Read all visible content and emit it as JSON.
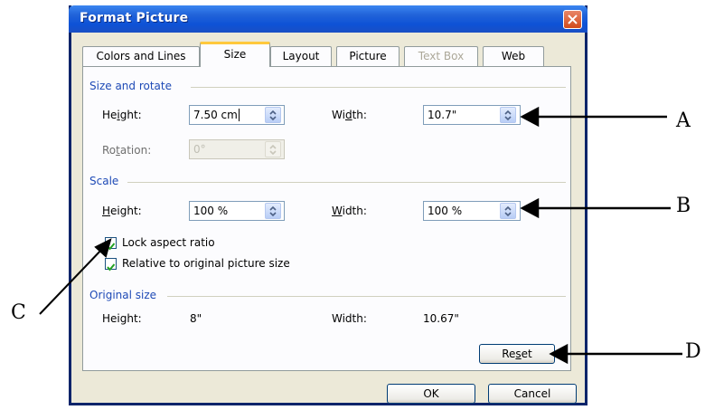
{
  "window": {
    "title": "Format Picture"
  },
  "tabs": [
    {
      "label": "Colors and Lines",
      "state": "normal"
    },
    {
      "label": "Size",
      "state": "active"
    },
    {
      "label": "Layout",
      "state": "normal"
    },
    {
      "label": "Picture",
      "state": "normal"
    },
    {
      "label": "Text Box",
      "state": "disabled"
    },
    {
      "label": "Web",
      "state": "normal"
    }
  ],
  "size_rotate": {
    "title": "Size and rotate",
    "height_label": "Height:",
    "height_value": "7.50 cm",
    "width_label": "Width:",
    "width_value": "10.7\"",
    "rotation_label": "Rotation:",
    "rotation_value": "0°"
  },
  "scale": {
    "title": "Scale",
    "height_label": "Height:",
    "height_value": "100 %",
    "width_label": "Width:",
    "width_value": "100 %",
    "lock_aspect_label": "Lock aspect ratio",
    "lock_aspect_checked": true,
    "relative_label": "Relative to original picture size",
    "relative_checked": true
  },
  "original_size": {
    "title": "Original size",
    "height_label": "Height:",
    "height_value": "8\"",
    "width_label": "Width:",
    "width_value": "10.67\""
  },
  "buttons": {
    "reset": "Reset",
    "ok": "OK",
    "cancel": "Cancel"
  },
  "callouts": {
    "a": "A",
    "b": "B",
    "c": "C",
    "d": "D"
  },
  "colors": {
    "title_bar": "#0d52d6",
    "dialog_bg": "#ece9d8",
    "section_title": "#1e4ab6",
    "close_button": "#d24b1c"
  }
}
